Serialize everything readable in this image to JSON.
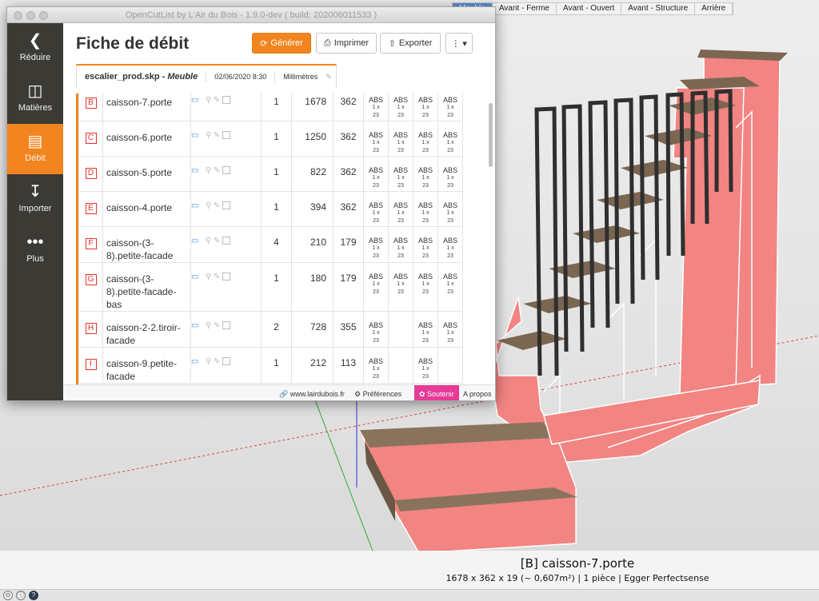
{
  "scene": {
    "tabs": [
      {
        "label": "Meuble",
        "active": true
      },
      {
        "label": "Avant - Ferme",
        "active": false
      },
      {
        "label": "Avant - Ouvert",
        "active": false
      },
      {
        "label": "Avant - Structure",
        "active": false
      },
      {
        "label": "Arrière",
        "active": false
      }
    ],
    "selection": {
      "title": "[B] caisson-7.porte",
      "subtitle": "1678 x 362 x 19 (~ 0,607m²) | 1 pièce | Egger Perfectsense"
    },
    "colors": {
      "panel": "#f28482",
      "highlight": "#f5880e",
      "wood": "#7b6651",
      "rail": "#2f2f2f"
    }
  },
  "window": {
    "title": "OpenCutList by L'Air du Bois - 1.9.0-dev ( build: 202006011533 )"
  },
  "sidebar": {
    "items": [
      {
        "label": "Réduire",
        "icon": "chevron-left-icon",
        "active": false
      },
      {
        "label": "Matières",
        "icon": "paint-bucket-icon",
        "active": false
      },
      {
        "label": "Débit",
        "icon": "cutlist-icon",
        "active": true
      },
      {
        "label": "Importer",
        "icon": "import-icon",
        "active": false
      },
      {
        "label": "Plus",
        "icon": "more-icon",
        "active": false
      }
    ]
  },
  "header": {
    "title": "Fiche de débit",
    "buttons": {
      "generate": "Générer",
      "print": "Imprimer",
      "export": "Exporter"
    }
  },
  "doc": {
    "filename": "escalier_prod.skp - ",
    "type": "Meuble",
    "date": "02/06/2020 8:30",
    "unit": "Millimètres"
  },
  "table": {
    "edge_label": "ABS",
    "edge_sub": "1 x",
    "edge_sub2": "23",
    "rows": [
      {
        "letter": "B",
        "name": "caisson-7.porte",
        "count": "1",
        "length": "1678",
        "width": "362",
        "edges": [
          true,
          true,
          true,
          true
        ]
      },
      {
        "letter": "C",
        "name": "caisson-6.porte",
        "count": "1",
        "length": "1250",
        "width": "362",
        "edges": [
          true,
          true,
          true,
          true
        ]
      },
      {
        "letter": "D",
        "name": "caisson-5.porte",
        "count": "1",
        "length": "822",
        "width": "362",
        "edges": [
          true,
          true,
          true,
          true
        ]
      },
      {
        "letter": "E",
        "name": "caisson-4.porte",
        "count": "1",
        "length": "394",
        "width": "362",
        "edges": [
          true,
          true,
          true,
          true
        ]
      },
      {
        "letter": "F",
        "name": "caisson-(3-8).petite-facade",
        "count": "4",
        "length": "210",
        "width": "179",
        "edges": [
          true,
          true,
          true,
          true
        ]
      },
      {
        "letter": "G",
        "name": "caisson-(3-8).petite-facade-bas",
        "count": "1",
        "length": "180",
        "width": "179",
        "edges": [
          true,
          true,
          true,
          true
        ]
      },
      {
        "letter": "H",
        "name": "caisson-2-2.tiroir-facade",
        "count": "2",
        "length": "728",
        "width": "355",
        "edges": [
          true,
          false,
          true,
          true
        ]
      },
      {
        "letter": "I",
        "name": "caisson-9.petite-facade",
        "count": "1",
        "length": "212",
        "width": "113",
        "edges": [
          true,
          false,
          true,
          false
        ]
      }
    ]
  },
  "footer": {
    "site": "www.lairdubois.fr",
    "prefs": "Préférences",
    "support": "Soutenir",
    "about": "A propos"
  }
}
